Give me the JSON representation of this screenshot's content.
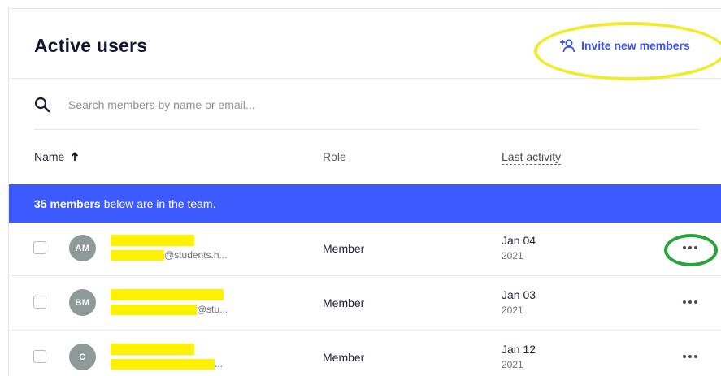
{
  "header": {
    "title": "Active users",
    "invite_label": "Invite new members",
    "invite_icon": "add-user-icon",
    "accent_color": "#3a53f0"
  },
  "search": {
    "placeholder": "Search members by name or email...",
    "value": ""
  },
  "columns": {
    "name": "Name",
    "role": "Role",
    "last_activity": "Last activity",
    "sort": "ascending"
  },
  "banner": {
    "count_label": "35 members",
    "suffix": "below are in the team.",
    "color": "#3d5aff"
  },
  "rows": [
    {
      "initials": "AM",
      "email_suffix": "@students.h...",
      "role": "Member",
      "date": "Jan 04",
      "year": "2021"
    },
    {
      "initials": "BM",
      "email_suffix": "@stu...",
      "role": "Member",
      "date": "Jan 03",
      "year": "2021"
    },
    {
      "initials": "C",
      "email_suffix": "...",
      "role": "Member",
      "date": "Jan 12",
      "year": "2021"
    }
  ],
  "annotations": {
    "highlight_invite_color": "#f2ea2a",
    "highlight_more_color": "#27a43a",
    "redaction_color": "#fff200"
  }
}
